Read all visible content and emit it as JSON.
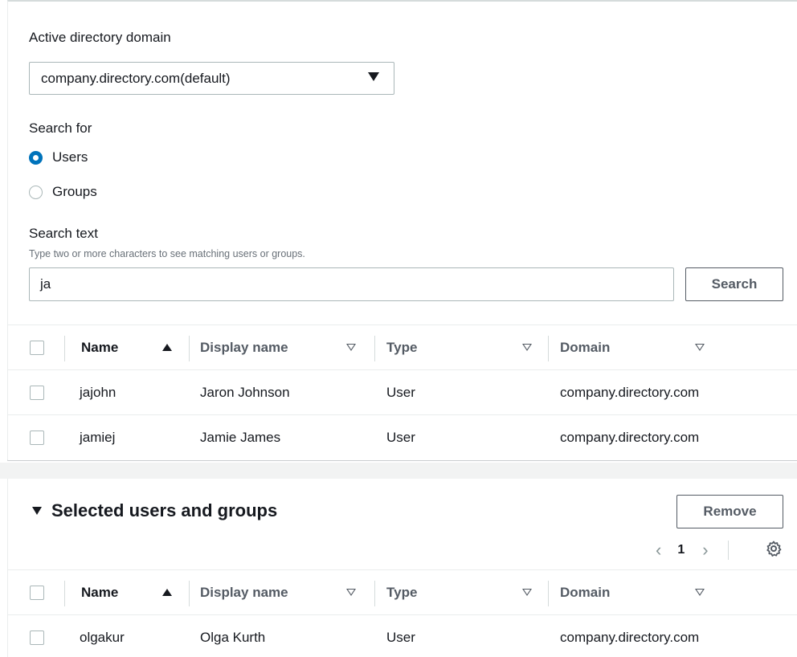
{
  "domain_select": {
    "label": "Active directory domain",
    "value": "company.directory.com(default)"
  },
  "search_for": {
    "label": "Search for",
    "options": [
      {
        "label": "Users",
        "selected": true
      },
      {
        "label": "Groups",
        "selected": false
      }
    ]
  },
  "search_text": {
    "label": "Search text",
    "hint": "Type two or more characters to see matching users or groups.",
    "value": "ja",
    "button_label": "Search"
  },
  "results_table": {
    "columns": [
      "Name",
      "Display name",
      "Type",
      "Domain"
    ],
    "rows": [
      {
        "name": "jajohn",
        "display_name": "Jaron Johnson",
        "type": "User",
        "domain": "company.directory.com"
      },
      {
        "name": "jamiej",
        "display_name": "Jamie James",
        "type": "User",
        "domain": "company.directory.com"
      }
    ]
  },
  "selected_section": {
    "title": "Selected users and groups",
    "remove_label": "Remove",
    "page": "1",
    "columns": [
      "Name",
      "Display name",
      "Type",
      "Domain"
    ],
    "rows": [
      {
        "name": "olgakur",
        "display_name": "Olga Kurth",
        "type": "User",
        "domain": "company.directory.com"
      }
    ]
  },
  "colors": {
    "accent": "#0073bb",
    "border": "#aab7b8",
    "text": "#16191f",
    "muted": "#687078"
  }
}
